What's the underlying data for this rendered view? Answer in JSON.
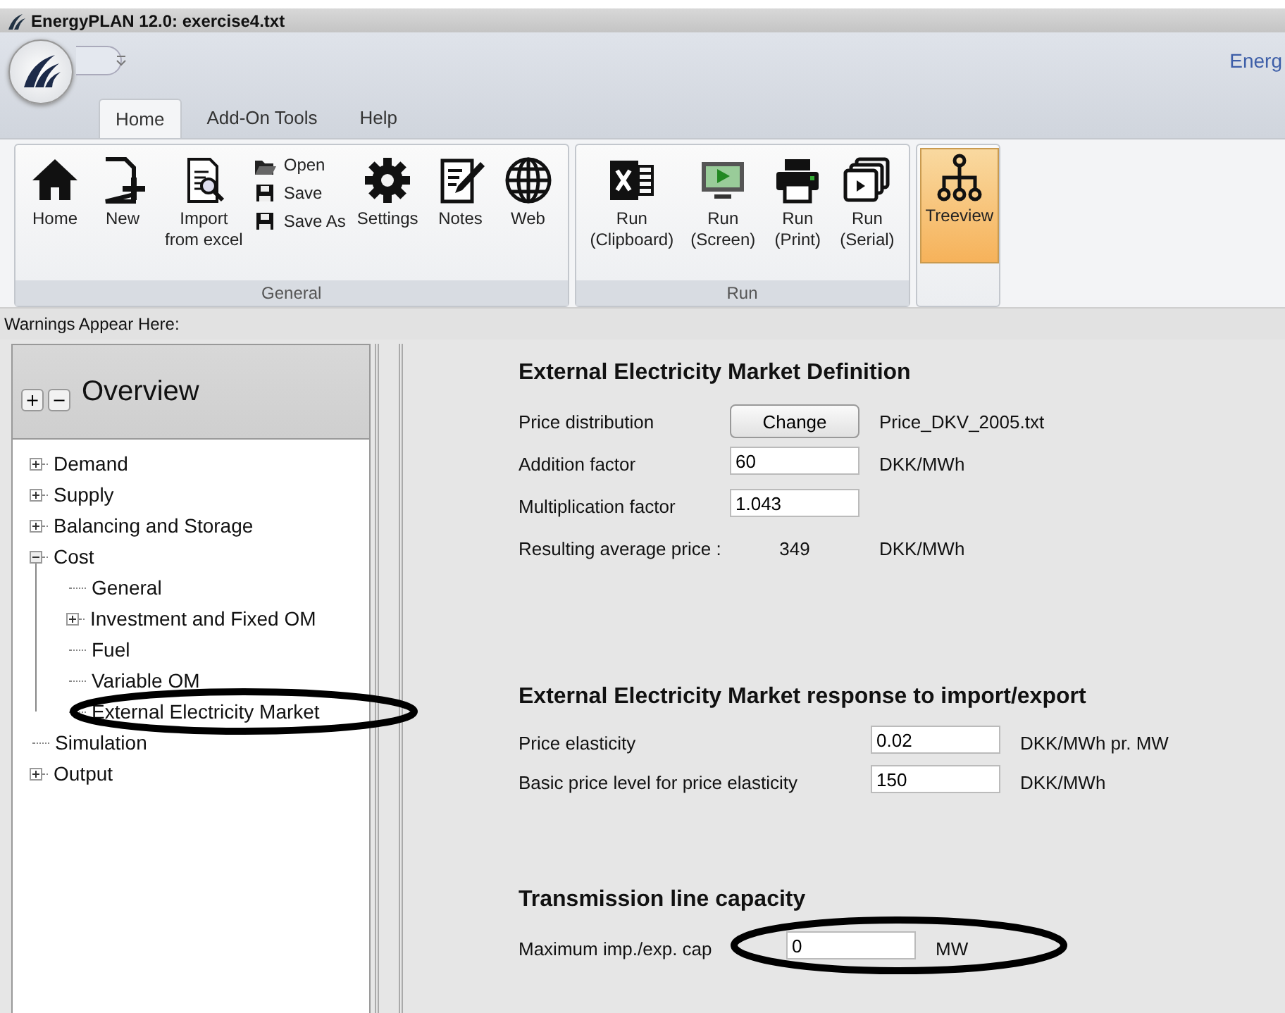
{
  "window": {
    "title": "EnergyPLAN 12.0: exercise4.txt",
    "brand_text": "Energ"
  },
  "tabs": [
    {
      "label": "Home",
      "selected": true
    },
    {
      "label": "Add-On Tools",
      "selected": false
    },
    {
      "label": "Help",
      "selected": false
    }
  ],
  "ribbon_groups": [
    {
      "label": "General",
      "items": [
        {
          "kind": "large",
          "label": "Home",
          "selected": false
        },
        {
          "kind": "large",
          "label": "New",
          "selected": false
        },
        {
          "kind": "large",
          "label": "Import\nfrom excel",
          "selected": false
        },
        {
          "kind": "stack",
          "items": [
            {
              "label": "Open"
            },
            {
              "label": "Save"
            },
            {
              "label": "Save As"
            }
          ]
        },
        {
          "kind": "large",
          "label": "Settings",
          "selected": false
        },
        {
          "kind": "large",
          "label": "Notes",
          "selected": false
        },
        {
          "kind": "large",
          "label": "Web",
          "selected": false
        }
      ]
    },
    {
      "label": "Run",
      "items": [
        {
          "kind": "large",
          "label": "Run\n(Clipboard)",
          "selected": false
        },
        {
          "kind": "large",
          "label": "Run\n(Screen)",
          "selected": false
        },
        {
          "kind": "large",
          "label": "Run\n(Print)",
          "selected": false
        },
        {
          "kind": "large",
          "label": "Run\n(Serial)",
          "selected": false
        }
      ]
    },
    {
      "items": [
        {
          "kind": "large",
          "label": "Treeview",
          "selected": true
        }
      ]
    }
  ],
  "warnings": "Warnings Appear Here:",
  "overview": {
    "title": "Overview",
    "buttons": [
      "+",
      "−"
    ],
    "tree": [
      {
        "label": "Demand",
        "kind": "node",
        "expanded": false,
        "circled": false
      },
      {
        "label": "Supply",
        "kind": "node",
        "expanded": false,
        "circled": false
      },
      {
        "label": "Balancing and Storage",
        "kind": "node",
        "expanded": false,
        "circled": false
      },
      {
        "label": "Cost",
        "kind": "node",
        "expanded": true,
        "circled": false,
        "children": [
          {
            "label": "General",
            "kind": "leaf",
            "circled": false
          },
          {
            "label": "Investment and Fixed OM",
            "kind": "node",
            "expanded": false,
            "circled": false
          },
          {
            "label": "Fuel",
            "kind": "leaf",
            "circled": false
          },
          {
            "label": "Variable OM",
            "kind": "leaf",
            "circled": false
          },
          {
            "label": "External Electricity Market",
            "kind": "leaf",
            "circled": true
          }
        ]
      },
      {
        "label": "Simulation",
        "kind": "leaf",
        "circled": false
      },
      {
        "label": "Output",
        "kind": "node",
        "expanded": false,
        "circled": false
      }
    ]
  },
  "sections": [
    {
      "title": "External Electricity Market Definition",
      "rows": [
        {
          "kind": "button",
          "label": "Price distribution",
          "button": "Change",
          "unit": "Price_DKV_2005.txt"
        },
        {
          "kind": "input",
          "label": "Addition factor",
          "value": "60",
          "unit": "DKK/MWh",
          "circled": false
        },
        {
          "kind": "input",
          "label": "Multiplication factor",
          "value": "1.043",
          "circled": false
        },
        {
          "kind": "value",
          "label": "Resulting average price :",
          "value": "349",
          "unit": "DKK/MWh"
        }
      ]
    },
    {
      "title": "External Electricity Market response to import/export",
      "rows": [
        {
          "kind": "input",
          "label": "Price elasticity",
          "value": "0.02",
          "unit": "DKK/MWh pr. MW",
          "circled": false
        },
        {
          "kind": "input",
          "label": "Basic price level for price elasticity",
          "value": "150",
          "unit": "DKK/MWh",
          "circled": false
        }
      ]
    },
    {
      "title": "Transmission line capacity",
      "rows": [
        {
          "kind": "input",
          "label": "Maximum imp./exp. cap",
          "value": "0",
          "unit": "MW",
          "circled": true
        }
      ]
    }
  ]
}
